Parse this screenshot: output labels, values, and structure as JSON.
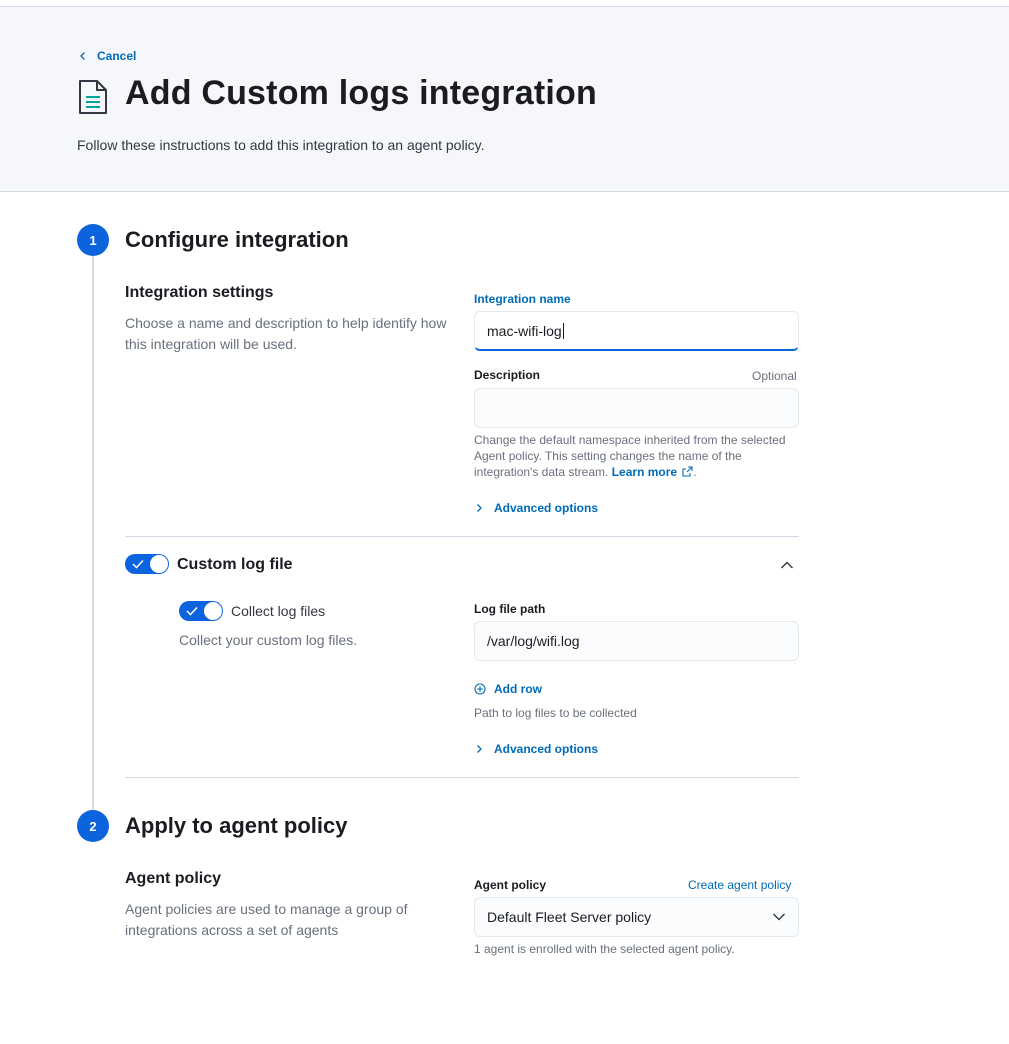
{
  "header": {
    "cancel_label": "Cancel",
    "title": "Add Custom logs integration",
    "subtitle": "Follow these instructions to add this integration to an agent policy."
  },
  "step1": {
    "number": "1",
    "title": "Configure integration",
    "settings": {
      "title": "Integration settings",
      "description": "Choose a name and description to help identify how this integration will be used.",
      "name_label": "Integration name",
      "name_value": "mac-wifi-log",
      "description_label": "Description",
      "optional_label": "Optional",
      "description_value": "",
      "help_text": "Change the default namespace inherited from the selected Agent policy. This setting changes the name of the integration's data stream.",
      "learn_more": "Learn more",
      "advanced_options": "Advanced options"
    },
    "custom_log": {
      "title": "Custom log file",
      "collect_label": "Collect log files",
      "collect_description": "Collect your custom log files.",
      "path_label": "Log file path",
      "path_value": "/var/log/wifi.log",
      "add_row": "Add row",
      "path_help": "Path to log files to be collected",
      "advanced_options": "Advanced options"
    }
  },
  "step2": {
    "number": "2",
    "title": "Apply to agent policy",
    "policy": {
      "title": "Agent policy",
      "description": "Agent policies are used to manage a group of integrations across a set of agents",
      "field_label": "Agent policy",
      "create_link": "Create agent policy",
      "selected": "Default Fleet Server policy",
      "help": "1 agent is enrolled with the selected agent policy."
    }
  },
  "colors": {
    "accent": "#0b64dd",
    "link": "#006bb8",
    "header_bg": "#f5f7fa"
  }
}
